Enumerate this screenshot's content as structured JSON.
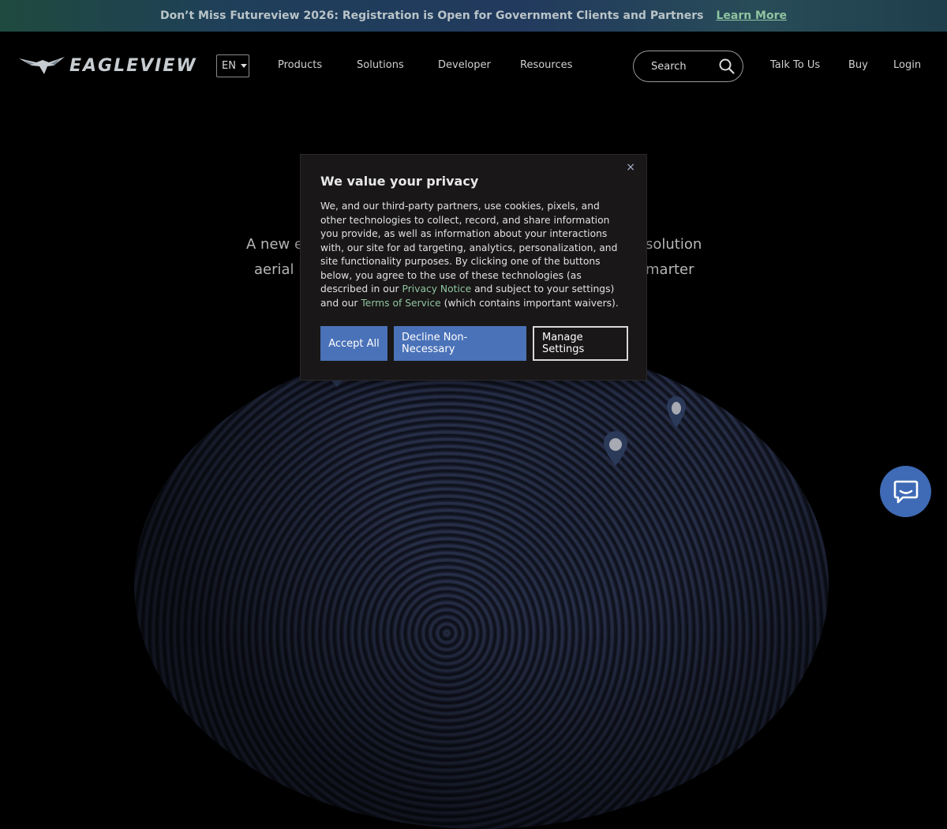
{
  "banner": {
    "text": "Don’t Miss Futureview 2026: Registration is Open for Government Clients and Partners",
    "link": "Learn More"
  },
  "header": {
    "logo": "EAGLEVIEW",
    "language": "EN",
    "nav": [
      "Products",
      "Solutions",
      "Developer",
      "Resources"
    ],
    "search_placeholder": "Search",
    "right_links": [
      "Talk To Us",
      "Buy",
      "Login"
    ]
  },
  "hero": {
    "line1_left": "A new er",
    "line1_right": "solution",
    "line2_left": "aerial i",
    "line2_right": "marter"
  },
  "cookie": {
    "close": "×",
    "title": "We value your privacy",
    "body_1": "We, and our third-party partners, use cookies, pixels, and other technologies to collect, record, and share information you provide, as well as information about your interactions with, our site for ad targeting, analytics, personalization, and site functionality purposes. By clicking one of the buttons below, you agree to the use of these technologies (as described in our ",
    "privacy_link": "Privacy Notice",
    "body_2": " and subject to your settings) and our ",
    "terms_link": "Terms of Service",
    "body_3": " (which contains important waivers).",
    "accept": "Accept All",
    "decline": "Decline Non-Necessary",
    "manage": "Manage Settings"
  },
  "colors": {
    "accent_blue": "#4a72b8",
    "link_green": "#8fc4a0",
    "chat_blue": "#3f6ab5"
  },
  "icons": {
    "search": "search-icon",
    "chat": "chat-icon",
    "close": "close-icon",
    "logo": "eagle-icon"
  }
}
